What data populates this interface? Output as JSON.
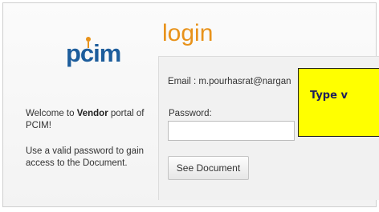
{
  "logo": {
    "text": "pcim"
  },
  "welcome": {
    "prefix": "Welcome to ",
    "bold": "Vendor",
    "suffix": " portal of PCIM!"
  },
  "note": "Use a valid password to gain access to the Document.",
  "login": {
    "title": "login",
    "email_line": "Email : m.pourhasrat@nargan",
    "password_label": "Password:",
    "password_value": "",
    "password_placeholder": "",
    "submit_label": "See Document"
  },
  "tooltip": {
    "text": "Type v"
  },
  "colors": {
    "accent": "#e8921a",
    "brand": "#1d5d9c",
    "tooltip_bg": "#ffff00"
  }
}
